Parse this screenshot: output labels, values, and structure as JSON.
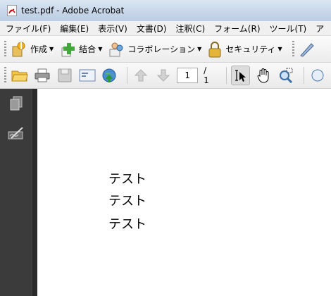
{
  "window": {
    "title": "test.pdf - Adobe Acrobat"
  },
  "menu": [
    "ファイル(F)",
    "編集(E)",
    "表示(V)",
    "文書(D)",
    "注釈(C)",
    "フォーム(R)",
    "ツール(T)",
    "ア"
  ],
  "toolbar1": {
    "create_label": "作成",
    "combine_label": "結合",
    "collaborate_label": "コラボレーション",
    "security_label": "セキュリティ"
  },
  "toolbar2": {
    "current_page": "1",
    "page_total": "/ 1"
  },
  "document": {
    "lines": [
      "テスト",
      "テスト",
      "テスト"
    ]
  }
}
